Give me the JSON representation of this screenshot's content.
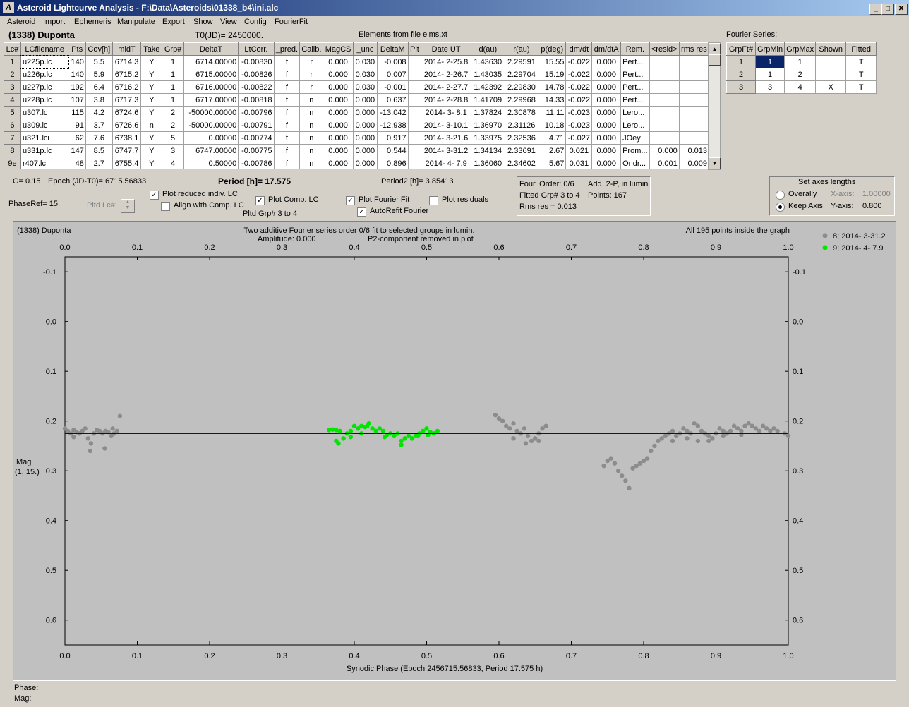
{
  "window": {
    "title": "Asteroid Lightcurve Analysis - F:\\Data\\Asteroids\\01338_b4\\ini.alc",
    "icon_name": "app-icon",
    "controls": {
      "minimize": "_",
      "maximize": "□",
      "close": "✕"
    }
  },
  "menu": [
    "Asteroid",
    "Import",
    "Ephemeris",
    "Manipulate",
    "Export",
    "Show",
    "View",
    "Config",
    "FourierFit"
  ],
  "header": {
    "object": "(1338) Duponta",
    "t0": "T0(JD)= 2450000.",
    "elements": "Elements from file elms.xt"
  },
  "lc_table": {
    "columns": [
      "Lc#",
      "LCfilename",
      "Pts",
      "Cov[h]",
      "midT",
      "Take",
      "Grp#",
      "DeltaT",
      "LtCorr.",
      "_pred.",
      "Calib.",
      "MagCS",
      "_unc",
      "DeltaM",
      "Plt",
      "Date UT",
      "d(au)",
      "r(au)",
      "p(deg)",
      "dm/dt",
      "dm/dtA",
      "Rem.",
      "<resid>",
      "rms res"
    ],
    "rows": [
      [
        "1",
        "u225p.lc",
        "140",
        "5.5",
        "6714.3",
        "Y",
        "1",
        "6714.00000",
        "-0.00830",
        "f",
        "r",
        "0.000",
        "0.030",
        "-0.008",
        "",
        "2014- 2-25.8",
        "1.43630",
        "2.29591",
        "15.55",
        "-0.022",
        "0.000",
        "Pert...",
        "",
        ""
      ],
      [
        "2",
        "u226p.lc",
        "140",
        "5.9",
        "6715.2",
        "Y",
        "1",
        "6715.00000",
        "-0.00826",
        "f",
        "r",
        "0.000",
        "0.030",
        "0.007",
        "",
        "2014- 2-26.7",
        "1.43035",
        "2.29704",
        "15.19",
        "-0.022",
        "0.000",
        "Pert...",
        "",
        ""
      ],
      [
        "3",
        "u227p.lc",
        "192",
        "6.4",
        "6716.2",
        "Y",
        "1",
        "6716.00000",
        "-0.00822",
        "f",
        "r",
        "0.000",
        "0.030",
        "-0.001",
        "",
        "2014- 2-27.7",
        "1.42392",
        "2.29830",
        "14.78",
        "-0.022",
        "0.000",
        "Pert...",
        "",
        ""
      ],
      [
        "4",
        "u228p.lc",
        "107",
        "3.8",
        "6717.3",
        "Y",
        "1",
        "6717.00000",
        "-0.00818",
        "f",
        "n",
        "0.000",
        "0.000",
        "0.637",
        "",
        "2014- 2-28.8",
        "1.41709",
        "2.29968",
        "14.33",
        "-0.022",
        "0.000",
        "Pert...",
        "",
        ""
      ],
      [
        "5",
        "u307.lc",
        "115",
        "4.2",
        "6724.6",
        "Y",
        "2",
        "-50000.00000",
        "-0.00796",
        "f",
        "n",
        "0.000",
        "0.000",
        "-13.042",
        "",
        "2014- 3- 8.1",
        "1.37824",
        "2.30878",
        "11.11",
        "-0.023",
        "0.000",
        "Lero...",
        "",
        ""
      ],
      [
        "6",
        "u309.lc",
        "91",
        "3.7",
        "6726.6",
        "n",
        "2",
        "-50000.00000",
        "-0.00791",
        "f",
        "n",
        "0.000",
        "0.000",
        "-12.938",
        "",
        "2014- 3-10.1",
        "1.36970",
        "2.31126",
        "10.18",
        "-0.023",
        "0.000",
        "Lero...",
        "",
        ""
      ],
      [
        "7",
        "u321.lci",
        "62",
        "7.6",
        "6738.1",
        "Y",
        "5",
        "0.00000",
        "-0.00774",
        "f",
        "n",
        "0.000",
        "0.000",
        "0.917",
        "",
        "2014- 3-21.6",
        "1.33975",
        "2.32536",
        "4.71",
        "-0.027",
        "0.000",
        "JOey",
        "",
        ""
      ],
      [
        "8",
        "u331p.lc",
        "147",
        "8.5",
        "6747.7",
        "Y",
        "3",
        "6747.00000",
        "-0.00775",
        "f",
        "n",
        "0.000",
        "0.000",
        "0.544",
        "",
        "2014- 3-31.2",
        "1.34134",
        "2.33691",
        "2.67",
        "0.021",
        "0.000",
        "Prom...",
        "0.000",
        "0.013"
      ],
      [
        "9e",
        "r407.lc",
        "48",
        "2.7",
        "6755.4",
        "Y",
        "4",
        "0.50000",
        "-0.00786",
        "f",
        "n",
        "0.000",
        "0.000",
        "0.896",
        "",
        "2014- 4- 7.9",
        "1.36060",
        "2.34602",
        "5.67",
        "0.031",
        "0.000",
        "Ondr...",
        "0.001",
        "0.009"
      ]
    ]
  },
  "fourier_series": {
    "label": "Fourier Series:",
    "columns": [
      "GrpFt#",
      "GrpMin",
      "GrpMax",
      "Shown",
      "Fitted"
    ],
    "rows": [
      [
        "1",
        "1",
        "1",
        "",
        "T"
      ],
      [
        "2",
        "1",
        "2",
        "",
        "T"
      ],
      [
        "3",
        "3",
        "4",
        "X",
        "T"
      ]
    ]
  },
  "params": {
    "g": "G= 0.15",
    "epoch": "Epoch (JD-T0)= 6715.56833",
    "period": "Period [h]= 17.575",
    "period2": "Period2 [h]= 3.85413",
    "phase_ref": "PhaseRef= 15.",
    "pltd_lc": "Pltd Lc#:",
    "pltd_grp": "Pltd Grp#  3   to   4"
  },
  "checkboxes": {
    "plot_reduced": {
      "label": "Plot reduced indiv. LC",
      "checked": "✓"
    },
    "align_comp": {
      "label": "Align with Comp. LC",
      "checked": ""
    },
    "plot_comp": {
      "label": "Plot Comp. LC",
      "checked": "✓"
    },
    "plot_fourier": {
      "label": "Plot Fourier Fit",
      "checked": "✓"
    },
    "plot_residuals": {
      "label": "Plot residuals",
      "checked": ""
    },
    "autorefit": {
      "label": "AutoRefit Fourier",
      "checked": "✓"
    }
  },
  "fit_info": {
    "order": "Four. Order:  0/6",
    "add": "Add. 2-P, in lumin.",
    "fitted": "Fitted Grp# 3 to 4",
    "points": "Points: 167",
    "rms": "Rms res     = 0.013"
  },
  "axes_lengths": {
    "title": "Set axes lengths",
    "overally": "Overally",
    "keep_axis": "Keep Axis",
    "x_label": "X-axis:",
    "x_value": "1.00000",
    "y_label": "Y-axis:",
    "y_value": "0.800"
  },
  "plot": {
    "top_left": "(1338) Duponta",
    "subtitle1": "Two additive Fourier series order 0/6 fit to selected groups in lumin.",
    "subtitle2a": "Amplitude: 0.000",
    "subtitle2b": "P2-component removed in plot",
    "top_right": "All 195 points inside the graph",
    "ylabel1": "Mag",
    "ylabel2": "(1, 15.)"
  },
  "status": {
    "phase": "Phase:",
    "mag": "Mag:"
  },
  "colors": {
    "gray_series": "#8c8c8c",
    "green_series": "#00e600",
    "plot_bg": "#c0c0c0"
  },
  "chart_data": {
    "type": "scatter",
    "xlabel": "Synodic Phase (Epoch 2456715.56833, Period 17.575 h)",
    "ylabel": "Mag",
    "xlim": [
      0,
      1
    ],
    "ylim": [
      0.65,
      -0.13
    ],
    "xticks": [
      "0.0",
      "0.1",
      "0.2",
      "0.3",
      "0.4",
      "0.5",
      "0.6",
      "0.7",
      "0.8",
      "0.9",
      "1.0"
    ],
    "yticks": [
      "-0.1",
      "0.0",
      "0.1",
      "0.2",
      "0.3",
      "0.4",
      "0.5",
      "0.6"
    ],
    "fit_line": 0.225,
    "series": [
      {
        "name": "8; 2014- 3-31.2",
        "color": "#8c8c8c",
        "points": [
          [
            0.0,
            0.215
          ],
          [
            0.004,
            0.22
          ],
          [
            0.008,
            0.225
          ],
          [
            0.012,
            0.218
          ],
          [
            0.016,
            0.222
          ],
          [
            0.02,
            0.225
          ],
          [
            0.024,
            0.22
          ],
          [
            0.028,
            0.215
          ],
          [
            0.032,
            0.235
          ],
          [
            0.036,
            0.245
          ],
          [
            0.04,
            0.225
          ],
          [
            0.044,
            0.218
          ],
          [
            0.048,
            0.22
          ],
          [
            0.052,
            0.225
          ],
          [
            0.056,
            0.22
          ],
          [
            0.06,
            0.222
          ],
          [
            0.064,
            0.23
          ],
          [
            0.068,
            0.225
          ],
          [
            0.072,
            0.22
          ],
          [
            0.076,
            0.19
          ],
          [
            0.035,
            0.26
          ],
          [
            0.055,
            0.255
          ],
          [
            0.012,
            0.232
          ],
          [
            0.066,
            0.215
          ],
          [
            0.595,
            0.188
          ],
          [
            0.6,
            0.195
          ],
          [
            0.605,
            0.2
          ],
          [
            0.61,
            0.21
          ],
          [
            0.615,
            0.215
          ],
          [
            0.62,
            0.205
          ],
          [
            0.625,
            0.22
          ],
          [
            0.63,
            0.225
          ],
          [
            0.635,
            0.215
          ],
          [
            0.64,
            0.23
          ],
          [
            0.645,
            0.24
          ],
          [
            0.65,
            0.235
          ],
          [
            0.655,
            0.225
          ],
          [
            0.66,
            0.215
          ],
          [
            0.665,
            0.21
          ],
          [
            0.62,
            0.235
          ],
          [
            0.637,
            0.245
          ],
          [
            0.655,
            0.24
          ],
          [
            0.745,
            0.29
          ],
          [
            0.75,
            0.28
          ],
          [
            0.755,
            0.275
          ],
          [
            0.76,
            0.285
          ],
          [
            0.765,
            0.3
          ],
          [
            0.77,
            0.31
          ],
          [
            0.775,
            0.32
          ],
          [
            0.78,
            0.335
          ],
          [
            0.785,
            0.295
          ],
          [
            0.79,
            0.29
          ],
          [
            0.795,
            0.285
          ],
          [
            0.8,
            0.28
          ],
          [
            0.805,
            0.275
          ],
          [
            0.81,
            0.26
          ],
          [
            0.815,
            0.25
          ],
          [
            0.82,
            0.24
          ],
          [
            0.825,
            0.235
          ],
          [
            0.83,
            0.23
          ],
          [
            0.835,
            0.225
          ],
          [
            0.84,
            0.22
          ],
          [
            0.845,
            0.23
          ],
          [
            0.85,
            0.225
          ],
          [
            0.855,
            0.215
          ],
          [
            0.86,
            0.22
          ],
          [
            0.865,
            0.225
          ],
          [
            0.87,
            0.205
          ],
          [
            0.875,
            0.21
          ],
          [
            0.88,
            0.22
          ],
          [
            0.885,
            0.225
          ],
          [
            0.89,
            0.23
          ],
          [
            0.895,
            0.235
          ],
          [
            0.9,
            0.225
          ],
          [
            0.905,
            0.215
          ],
          [
            0.91,
            0.22
          ],
          [
            0.915,
            0.225
          ],
          [
            0.92,
            0.22
          ],
          [
            0.925,
            0.21
          ],
          [
            0.93,
            0.215
          ],
          [
            0.935,
            0.22
          ],
          [
            0.94,
            0.21
          ],
          [
            0.945,
            0.205
          ],
          [
            0.95,
            0.21
          ],
          [
            0.955,
            0.215
          ],
          [
            0.96,
            0.22
          ],
          [
            0.965,
            0.21
          ],
          [
            0.97,
            0.215
          ],
          [
            0.975,
            0.22
          ],
          [
            0.98,
            0.215
          ],
          [
            0.985,
            0.22
          ],
          [
            0.995,
            0.225
          ],
          [
            1.0,
            0.23
          ],
          [
            0.84,
            0.24
          ],
          [
            0.86,
            0.235
          ],
          [
            0.875,
            0.24
          ],
          [
            0.89,
            0.24
          ],
          [
            0.91,
            0.23
          ],
          [
            0.935,
            0.228
          ]
        ]
      },
      {
        "name": "9; 2014- 4- 7.9",
        "color": "#00e600",
        "points": [
          [
            0.365,
            0.218
          ],
          [
            0.37,
            0.217
          ],
          [
            0.375,
            0.218
          ],
          [
            0.38,
            0.22
          ],
          [
            0.385,
            0.235
          ],
          [
            0.39,
            0.225
          ],
          [
            0.395,
            0.22
          ],
          [
            0.4,
            0.21
          ],
          [
            0.405,
            0.215
          ],
          [
            0.41,
            0.21
          ],
          [
            0.415,
            0.212
          ],
          [
            0.42,
            0.205
          ],
          [
            0.425,
            0.215
          ],
          [
            0.43,
            0.22
          ],
          [
            0.435,
            0.215
          ],
          [
            0.44,
            0.22
          ],
          [
            0.445,
            0.228
          ],
          [
            0.45,
            0.225
          ],
          [
            0.455,
            0.23
          ],
          [
            0.46,
            0.225
          ],
          [
            0.465,
            0.24
          ],
          [
            0.47,
            0.235
          ],
          [
            0.475,
            0.23
          ],
          [
            0.48,
            0.235
          ],
          [
            0.485,
            0.23
          ],
          [
            0.49,
            0.225
          ],
          [
            0.495,
            0.22
          ],
          [
            0.5,
            0.215
          ],
          [
            0.505,
            0.222
          ],
          [
            0.51,
            0.225
          ],
          [
            0.515,
            0.22
          ],
          [
            0.378,
            0.245
          ],
          [
            0.395,
            0.232
          ],
          [
            0.418,
            0.21
          ],
          [
            0.442,
            0.232
          ],
          [
            0.465,
            0.248
          ],
          [
            0.488,
            0.23
          ],
          [
            0.502,
            0.228
          ],
          [
            0.375,
            0.24
          ],
          [
            0.41,
            0.225
          ]
        ]
      }
    ]
  }
}
